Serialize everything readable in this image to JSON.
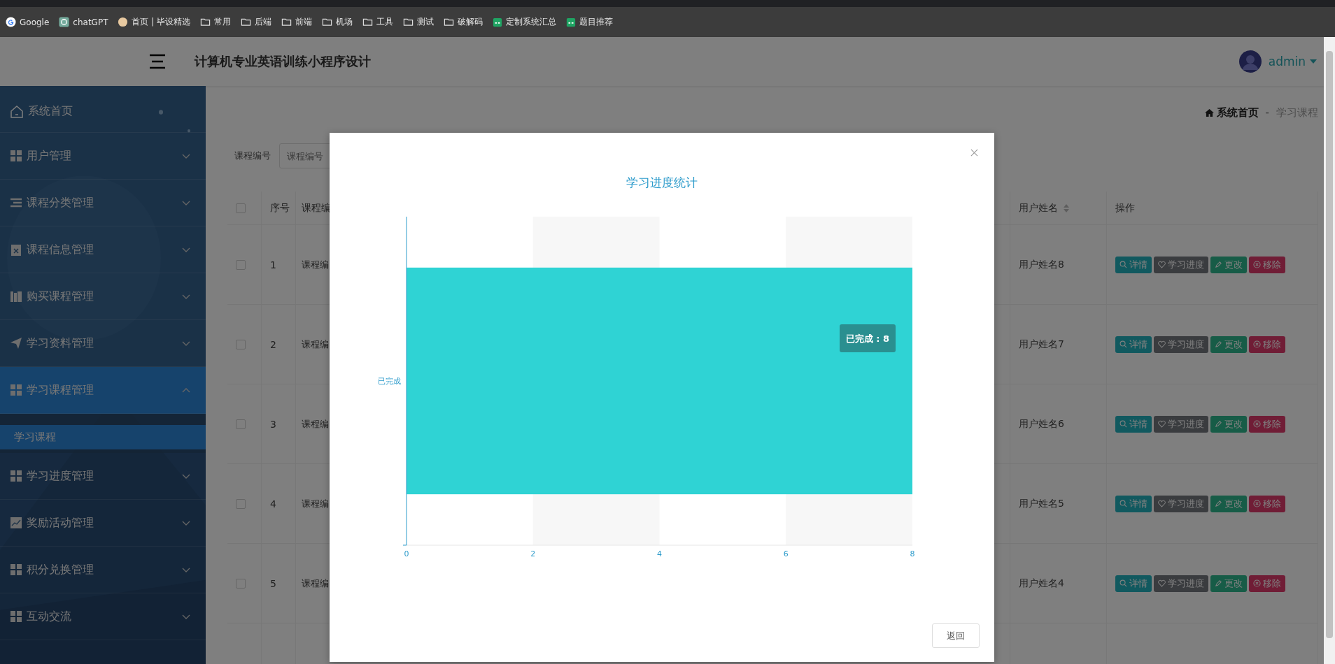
{
  "bookmarks": [
    {
      "label": "Google",
      "kind": "site"
    },
    {
      "label": "chatGPT",
      "kind": "site"
    },
    {
      "label": "首页 | 毕设精选",
      "kind": "site"
    },
    {
      "label": "常用",
      "kind": "folder"
    },
    {
      "label": "后端",
      "kind": "folder"
    },
    {
      "label": "前端",
      "kind": "folder"
    },
    {
      "label": "机场",
      "kind": "folder"
    },
    {
      "label": "工具",
      "kind": "folder"
    },
    {
      "label": "测试",
      "kind": "folder"
    },
    {
      "label": "破解码",
      "kind": "folder"
    },
    {
      "label": "定制系统汇总",
      "kind": "sheet"
    },
    {
      "label": "题目推荐",
      "kind": "sheet"
    }
  ],
  "header": {
    "title": "计算机专业英语训练小程序设计",
    "user": "admin"
  },
  "sidebar": {
    "items": [
      {
        "label": "系统首页",
        "expanded": false
      },
      {
        "label": "用户管理",
        "expanded": false
      },
      {
        "label": "课程分类管理",
        "expanded": false
      },
      {
        "label": "课程信息管理",
        "expanded": false
      },
      {
        "label": "购买课程管理",
        "expanded": false
      },
      {
        "label": "学习资料管理",
        "expanded": false
      },
      {
        "label": "学习课程管理",
        "expanded": true,
        "children": [
          {
            "label": "学习课程",
            "selected": true
          }
        ]
      },
      {
        "label": "学习进度管理",
        "expanded": false
      },
      {
        "label": "奖励活动管理",
        "expanded": false
      },
      {
        "label": "积分兑换管理",
        "expanded": false
      },
      {
        "label": "互动交流",
        "expanded": false
      }
    ]
  },
  "breadcrumb": {
    "home": "系统首页",
    "separator": "-",
    "current": "学习课程"
  },
  "search": {
    "label": "课程编号",
    "placeholder": "课程编号"
  },
  "table": {
    "all_checked": false,
    "columns": [
      {
        "label": "序号",
        "sortable": false
      },
      {
        "label": "课程编",
        "sortable": false
      },
      {
        "label": "用户姓名",
        "sortable": true
      },
      {
        "label": "操作",
        "sortable": false
      }
    ],
    "rows": [
      {
        "checked": false,
        "index": "1",
        "course_no": "课程编",
        "user_name": "用户姓名8",
        "actions": [
          {
            "label": "详情",
            "kind": "detail"
          },
          {
            "label": "学习进度",
            "kind": "progress"
          },
          {
            "label": "更改",
            "kind": "edit"
          },
          {
            "label": "移除",
            "kind": "remove"
          }
        ]
      },
      {
        "checked": false,
        "index": "2",
        "course_no": "课程编",
        "user_name": "用户姓名7",
        "actions": [
          {
            "label": "详情",
            "kind": "detail"
          },
          {
            "label": "学习进度",
            "kind": "progress"
          },
          {
            "label": "更改",
            "kind": "edit"
          },
          {
            "label": "移除",
            "kind": "remove"
          }
        ]
      },
      {
        "checked": false,
        "index": "3",
        "course_no": "课程编",
        "user_name": "用户姓名6",
        "actions": [
          {
            "label": "详情",
            "kind": "detail"
          },
          {
            "label": "学习进度",
            "kind": "progress"
          },
          {
            "label": "更改",
            "kind": "edit"
          },
          {
            "label": "移除",
            "kind": "remove"
          }
        ]
      },
      {
        "checked": false,
        "index": "4",
        "course_no": "课程编",
        "user_name": "用户姓名5",
        "actions": [
          {
            "label": "详情",
            "kind": "detail"
          },
          {
            "label": "学习进度",
            "kind": "progress"
          },
          {
            "label": "更改",
            "kind": "edit"
          },
          {
            "label": "移除",
            "kind": "remove"
          }
        ]
      },
      {
        "checked": false,
        "index": "5",
        "course_no": "课程编",
        "user_name": "用户姓名4",
        "actions": [
          {
            "label": "详情",
            "kind": "detail"
          },
          {
            "label": "学习进度",
            "kind": "progress"
          },
          {
            "label": "更改",
            "kind": "edit"
          },
          {
            "label": "移除",
            "kind": "remove"
          }
        ]
      }
    ]
  },
  "modal": {
    "title": "学习进度统计",
    "tooltip": "已完成 : 8",
    "button": "返回",
    "chart_data": {
      "type": "bar",
      "orientation": "horizontal",
      "categories": [
        "已完成"
      ],
      "values": [
        8
      ],
      "xlim": [
        0,
        8
      ],
      "xticks": [
        0,
        2,
        4,
        6,
        8
      ]
    }
  }
}
